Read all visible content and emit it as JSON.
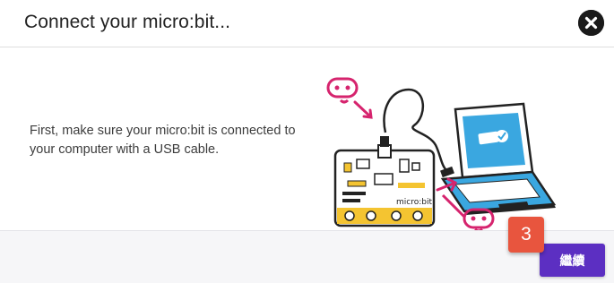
{
  "dialog": {
    "title": "Connect your micro:bit...",
    "instruction": "First, make sure your micro:bit is connected to your computer with a USB cable.",
    "board_label": "micro:bit",
    "continue_label": "繼續",
    "step_badge": "3"
  },
  "colors": {
    "accent": "#5c2fc2",
    "badge": "#e8553e",
    "illustration_pink": "#d6246e",
    "board_gold": "#f4c431",
    "screen_blue": "#3aa7e0"
  },
  "icons": {
    "close": "close-circle-icon",
    "illustration": "microbit-usb-laptop-illustration"
  }
}
